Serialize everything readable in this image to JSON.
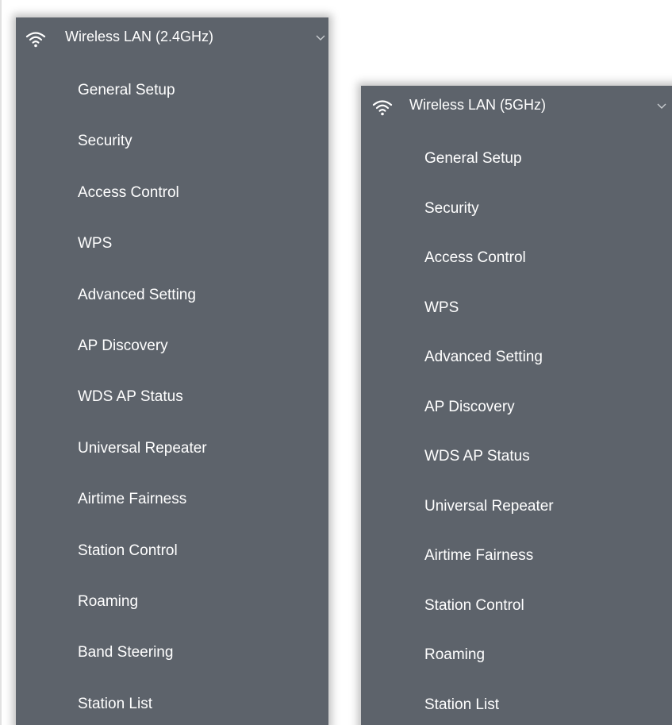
{
  "colors": {
    "panel_bg": "#5d636b",
    "text": "#ffffff",
    "page_bg": "#ffffff"
  },
  "panels": [
    {
      "header": {
        "icon": "wifi-icon",
        "label": "Wireless LAN (2.4GHz)",
        "expand_icon": "chevron-down-icon"
      },
      "items": [
        "General Setup",
        "Security",
        "Access Control",
        "WPS",
        "Advanced Setting",
        "AP Discovery",
        "WDS AP Status",
        "Universal Repeater",
        "Airtime Fairness",
        "Station Control",
        "Roaming",
        "Band Steering",
        "Station List"
      ]
    },
    {
      "header": {
        "icon": "wifi-icon",
        "label": "Wireless LAN (5GHz)",
        "expand_icon": "chevron-down-icon"
      },
      "items": [
        "General Setup",
        "Security",
        "Access Control",
        "WPS",
        "Advanced Setting",
        "AP Discovery",
        "WDS AP Status",
        "Universal Repeater",
        "Airtime Fairness",
        "Station Control",
        "Roaming",
        "Station List"
      ]
    }
  ]
}
